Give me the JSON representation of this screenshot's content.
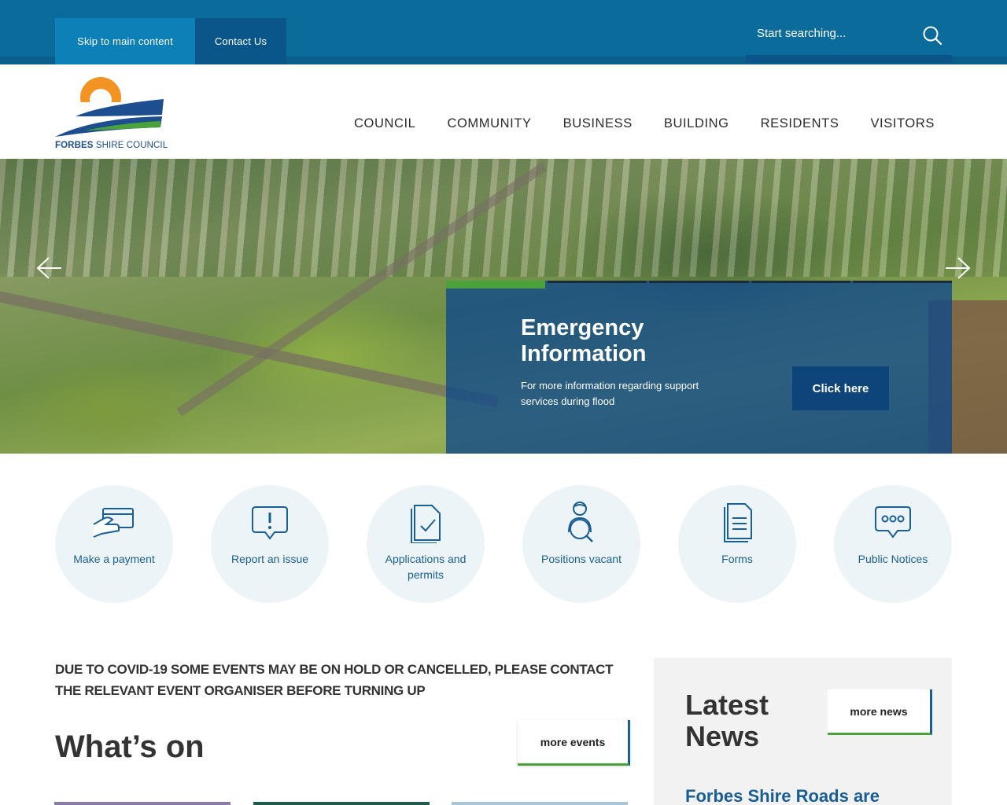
{
  "topbar": {
    "skip_label": "Skip to main content",
    "contact_label": "Contact Us",
    "search_placeholder": "Start searching..."
  },
  "header": {
    "logo_bold": "FORBES",
    "logo_rest": " SHIRE COUNCIL",
    "nav": [
      "COUNCIL",
      "COMMUNITY",
      "BUSINESS",
      "BUILDING",
      "RESIDENTS",
      "VISITORS"
    ]
  },
  "hero": {
    "title": "Emergency Information",
    "description": "For more information regarding support services during flood",
    "button_label": "Click here",
    "slides_total": 5,
    "active_slide": 1
  },
  "quick_links": [
    {
      "label": "Make a payment",
      "icon": "payment-card-icon"
    },
    {
      "label": "Report an issue",
      "icon": "report-issue-icon"
    },
    {
      "label": "Applications and permits",
      "icon": "applications-icon"
    },
    {
      "label": "Positions vacant",
      "icon": "positions-icon"
    },
    {
      "label": "Forms",
      "icon": "forms-icon"
    },
    {
      "label": "Public Notices",
      "icon": "notices-icon"
    }
  ],
  "events": {
    "notice": "DUE TO COVID-19 SOME EVENTS MAY BE ON HOLD OR CANCELLED, PLEASE CONTACT THE RELEVANT EVENT ORGANISER BEFORE TURNING UP",
    "title": "What’s on",
    "more_label": "more events"
  },
  "news": {
    "title": "Latest News",
    "more_label": "more news",
    "headline": "Forbes Shire Roads are"
  },
  "colors": {
    "primary": "#0b6b9a",
    "dark_blue": "#0a558a",
    "accent_green": "#4ba13a",
    "link_blue": "#1a5f93",
    "logo_orange": "#f39323"
  }
}
